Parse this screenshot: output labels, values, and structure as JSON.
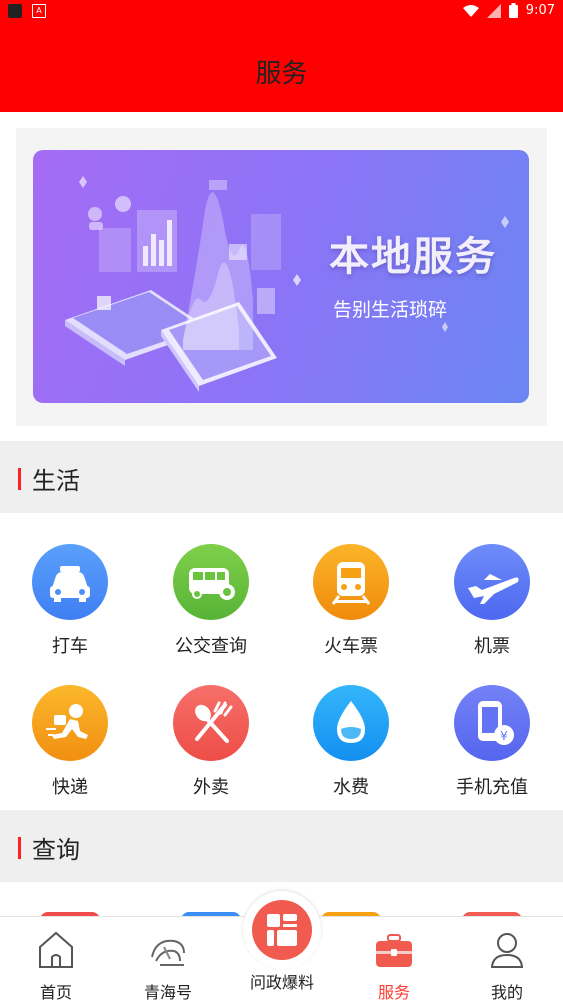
{
  "status_bar": {
    "time": "9:07"
  },
  "header": {
    "title": "服务"
  },
  "banner": {
    "title": "本地服务",
    "subtitle": "告别生活琐碎"
  },
  "sections": {
    "life": {
      "title": "生活"
    },
    "query": {
      "title": "查询"
    }
  },
  "life_items": [
    {
      "label": "打车",
      "icon": "taxi-icon",
      "color": "#4d8ff8"
    },
    {
      "label": "公交查询",
      "icon": "bus-icon",
      "color": "#69c43d"
    },
    {
      "label": "火车票",
      "icon": "train-icon",
      "color": "#f7a014"
    },
    {
      "label": "机票",
      "icon": "airplane-icon",
      "color": "#5b7cf6"
    },
    {
      "label": "快递",
      "icon": "courier-icon",
      "color": "#f7a51b"
    },
    {
      "label": "外卖",
      "icon": "fork-spoon-icon",
      "color": "#f25c55"
    },
    {
      "label": "水费",
      "icon": "water-drop-icon",
      "color": "#22a5f4"
    },
    {
      "label": "手机充值",
      "icon": "phone-recharge-icon",
      "color": "#6373f2"
    }
  ],
  "tabbar": {
    "home": "首页",
    "qinghai": "青海号",
    "report": "问政爆料",
    "service": "服务",
    "mine": "我的",
    "active_color": "#ff3b30"
  }
}
